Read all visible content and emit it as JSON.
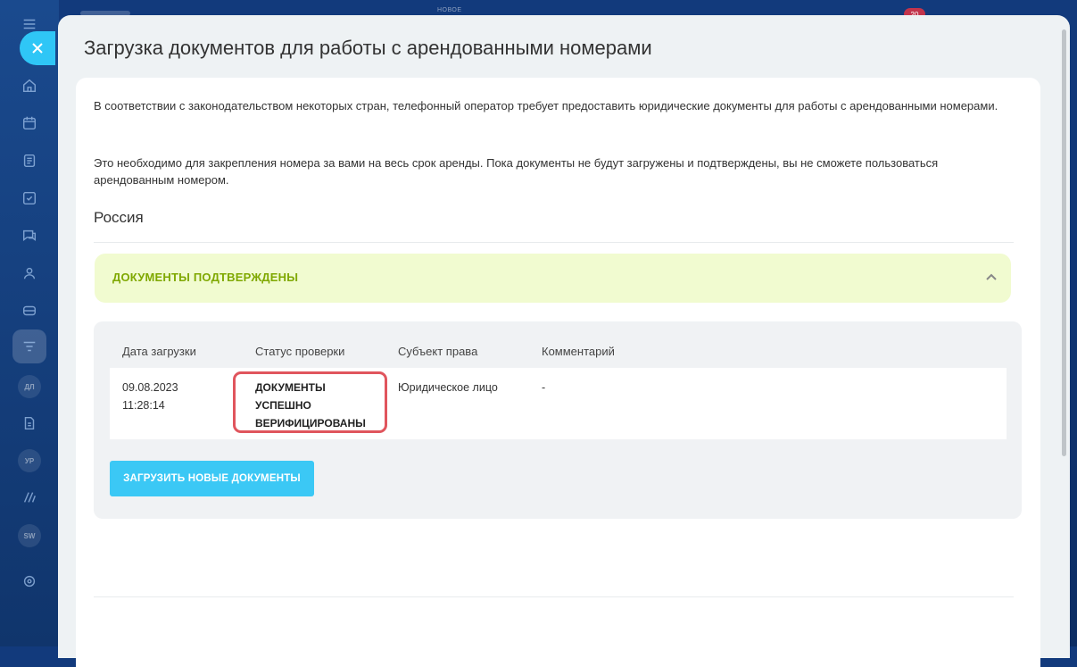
{
  "topbar": {
    "hint": "НОВОЕ",
    "count": "20"
  },
  "sidebar": {
    "badges": [
      "ДЛ",
      "УР",
      "SW"
    ]
  },
  "slider": {
    "title": "Загрузка документов для работы с арендованными номерами"
  },
  "content": {
    "paragraph1": "В соответствии с законодательством некоторых стран, телефонный оператор требует предоставить юридические документы для работы с арендованными номерами.",
    "paragraph2": "Это необходимо для закрепления номера за вами на весь срок аренды. Пока документы не будут загружены и подтверждены, вы не сможете пользоваться арендованным номером.",
    "country": "Россия",
    "banner_title": "ДОКУМЕНТЫ ПОДТВЕРЖДЕНЫ",
    "banner_color": "#7fa800"
  },
  "table": {
    "headers": [
      "Дата загрузки",
      "Статус проверки",
      "Субъект права",
      "Комментарий"
    ],
    "rows": [
      {
        "date": "09.08.2023",
        "time": "11:28:14",
        "status_line1": "ДОКУМЕНТЫ",
        "status_line2": "УСПЕШНО",
        "status_line3": "ВЕРИФИЦИРОВАНЫ",
        "subject": "Юридическое лицо",
        "comment": "-"
      }
    ]
  },
  "actions": {
    "upload_label": "ЗАГРУЗИТЬ НОВЫЕ ДОКУМЕНТЫ",
    "accent": "#3bc8f5"
  },
  "icons": {
    "close": "close-icon",
    "expand": "chevron-up-icon"
  }
}
